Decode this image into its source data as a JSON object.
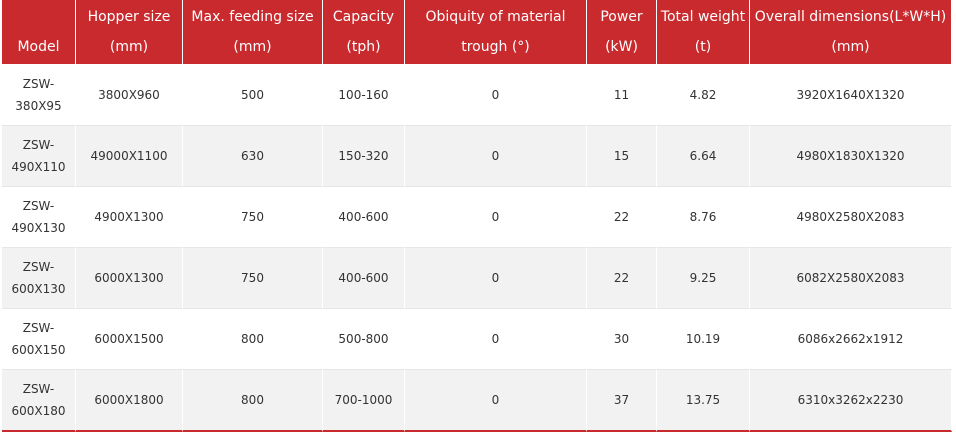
{
  "table": {
    "headers": [
      [
        "",
        "Model"
      ],
      [
        "Hopper size",
        "(mm)"
      ],
      [
        "Max. feeding size",
        "(mm)"
      ],
      [
        "Capacity",
        "(tph)"
      ],
      [
        "Obiquity of material",
        "trough (°)"
      ],
      [
        "Power",
        "(kW)"
      ],
      [
        "Total weight",
        "(t)"
      ],
      [
        "Overall dimensions(L*W*H)",
        "(mm)"
      ]
    ],
    "rows": [
      [
        "ZSW-",
        "380X95",
        "3800X960",
        "500",
        "100-160",
        "0",
        "11",
        "4.82",
        "3920X1640X1320"
      ],
      [
        "ZSW-",
        "490X110",
        "49000X1100",
        "630",
        "150-320",
        "0",
        "15",
        "6.64",
        "4980X1830X1320"
      ],
      [
        "ZSW-",
        "490X130",
        "4900X1300",
        "750",
        "400-600",
        "0",
        "22",
        "8.76",
        "4980X2580X2083"
      ],
      [
        "ZSW-",
        "600X130",
        "6000X1300",
        "750",
        "400-600",
        "0",
        "22",
        "9.25",
        "6082X2580X2083"
      ],
      [
        "ZSW-",
        "600X150",
        "6000X1500",
        "800",
        "500-800",
        "0",
        "30",
        "10.19",
        "6086x2662x1912"
      ],
      [
        "ZSW-",
        "600X180",
        "6000X1800",
        "800",
        "700-1000",
        "0",
        "37",
        "13.75",
        "6310x3262x2230"
      ]
    ]
  },
  "colors": {
    "header_bg": "#c92a2e",
    "header_text": "#ffffff",
    "row_alt": "#f2f2f2"
  }
}
